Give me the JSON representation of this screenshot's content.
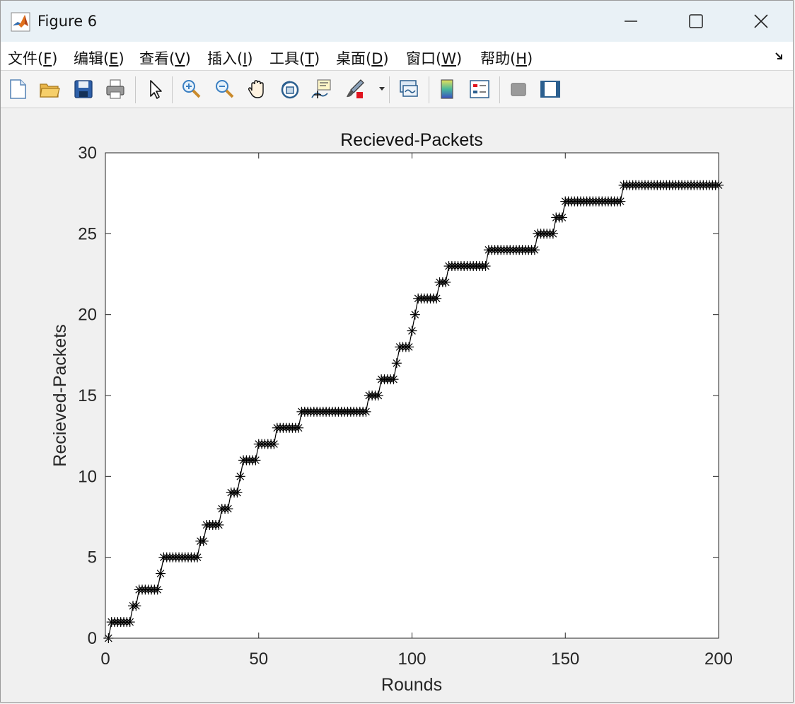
{
  "window": {
    "title": "Figure 6",
    "controls": {
      "minimize": "minimize",
      "maximize": "maximize",
      "close": "close"
    }
  },
  "menu": {
    "items": [
      {
        "text": "文件(",
        "key": "F",
        "end": ")"
      },
      {
        "text": "编辑(",
        "key": "E",
        "end": ")"
      },
      {
        "text": "查看(",
        "key": "V",
        "end": ")"
      },
      {
        "text": "插入(",
        "key": "I",
        "end": ")"
      },
      {
        "text": "工具(",
        "key": "T",
        "end": ")"
      },
      {
        "text": "桌面(",
        "key": "D",
        "end": ")"
      },
      {
        "text": "窗口(",
        "key": "W",
        "end": ")"
      },
      {
        "text": "帮助(",
        "key": "H",
        "end": ")"
      }
    ]
  },
  "toolbar": {
    "tools": [
      "new-figure",
      "open",
      "save",
      "print",
      "edit-plot",
      "zoom-in",
      "zoom-out",
      "pan",
      "rotate-3d",
      "data-cursor",
      "brush",
      "link",
      "colorbar",
      "legend",
      "hide-plot-tools",
      "show-plot-tools"
    ]
  },
  "chart_data": {
    "type": "line",
    "title": "Recieved-Packets",
    "xlabel": "Rounds",
    "ylabel": "Recieved-Packets",
    "xlim": [
      0,
      200
    ],
    "ylim": [
      0,
      30
    ],
    "xticks": [
      0,
      50,
      100,
      150,
      200
    ],
    "yticks": [
      0,
      5,
      10,
      15,
      20,
      25,
      30
    ],
    "marker": "*",
    "line_color": "#000000",
    "grid": false,
    "x": [
      1,
      2,
      3,
      4,
      5,
      6,
      7,
      8,
      9,
      10,
      11,
      12,
      13,
      14,
      15,
      16,
      17,
      18,
      19,
      20,
      21,
      22,
      23,
      24,
      25,
      26,
      27,
      28,
      29,
      30,
      31,
      32,
      33,
      34,
      35,
      36,
      37,
      38,
      39,
      40,
      41,
      42,
      43,
      44,
      45,
      46,
      47,
      48,
      49,
      50,
      51,
      52,
      53,
      54,
      55,
      56,
      57,
      58,
      59,
      60,
      61,
      62,
      63,
      64,
      65,
      66,
      67,
      68,
      69,
      70,
      71,
      72,
      73,
      74,
      75,
      76,
      77,
      78,
      79,
      80,
      81,
      82,
      83,
      84,
      85,
      86,
      87,
      88,
      89,
      90,
      91,
      92,
      93,
      94,
      95,
      96,
      97,
      98,
      99,
      100,
      101,
      102,
      103,
      104,
      105,
      106,
      107,
      108,
      109,
      110,
      111,
      112,
      113,
      114,
      115,
      116,
      117,
      118,
      119,
      120,
      121,
      122,
      123,
      124,
      125,
      126,
      127,
      128,
      129,
      130,
      131,
      132,
      133,
      134,
      135,
      136,
      137,
      138,
      139,
      140,
      141,
      142,
      143,
      144,
      145,
      146,
      147,
      148,
      149,
      150,
      151,
      152,
      153,
      154,
      155,
      156,
      157,
      158,
      159,
      160,
      161,
      162,
      163,
      164,
      165,
      166,
      167,
      168,
      169,
      170,
      171,
      172,
      173,
      174,
      175,
      176,
      177,
      178,
      179,
      180,
      181,
      182,
      183,
      184,
      185,
      186,
      187,
      188,
      189,
      190,
      191,
      192,
      193,
      194,
      195,
      196,
      197,
      198,
      199,
      200
    ],
    "y": [
      0,
      1,
      1,
      1,
      1,
      1,
      1,
      1,
      2,
      2,
      3,
      3,
      3,
      3,
      3,
      3,
      3,
      4,
      5,
      5,
      5,
      5,
      5,
      5,
      5,
      5,
      5,
      5,
      5,
      5,
      6,
      6,
      7,
      7,
      7,
      7,
      7,
      8,
      8,
      8,
      9,
      9,
      9,
      10,
      11,
      11,
      11,
      11,
      11,
      12,
      12,
      12,
      12,
      12,
      12,
      13,
      13,
      13,
      13,
      13,
      13,
      13,
      13,
      14,
      14,
      14,
      14,
      14,
      14,
      14,
      14,
      14,
      14,
      14,
      14,
      14,
      14,
      14,
      14,
      14,
      14,
      14,
      14,
      14,
      14,
      15,
      15,
      15,
      15,
      16,
      16,
      16,
      16,
      16,
      17,
      18,
      18,
      18,
      18,
      19,
      20,
      21,
      21,
      21,
      21,
      21,
      21,
      21,
      22,
      22,
      22,
      23,
      23,
      23,
      23,
      23,
      23,
      23,
      23,
      23,
      23,
      23,
      23,
      23,
      24,
      24,
      24,
      24,
      24,
      24,
      24,
      24,
      24,
      24,
      24,
      24,
      24,
      24,
      24,
      24,
      25,
      25,
      25,
      25,
      25,
      25,
      26,
      26,
      26,
      27,
      27,
      27,
      27,
      27,
      27,
      27,
      27,
      27,
      27,
      27,
      27,
      27,
      27,
      27,
      27,
      27,
      27,
      27,
      28,
      28,
      28,
      28,
      28,
      28,
      28,
      28,
      28,
      28,
      28,
      28,
      28,
      28,
      28,
      28,
      28,
      28,
      28,
      28,
      28,
      28,
      28,
      28,
      28,
      28,
      28,
      28,
      28,
      28,
      28,
      28,
      28,
      28,
      28,
      28,
      28
    ]
  }
}
